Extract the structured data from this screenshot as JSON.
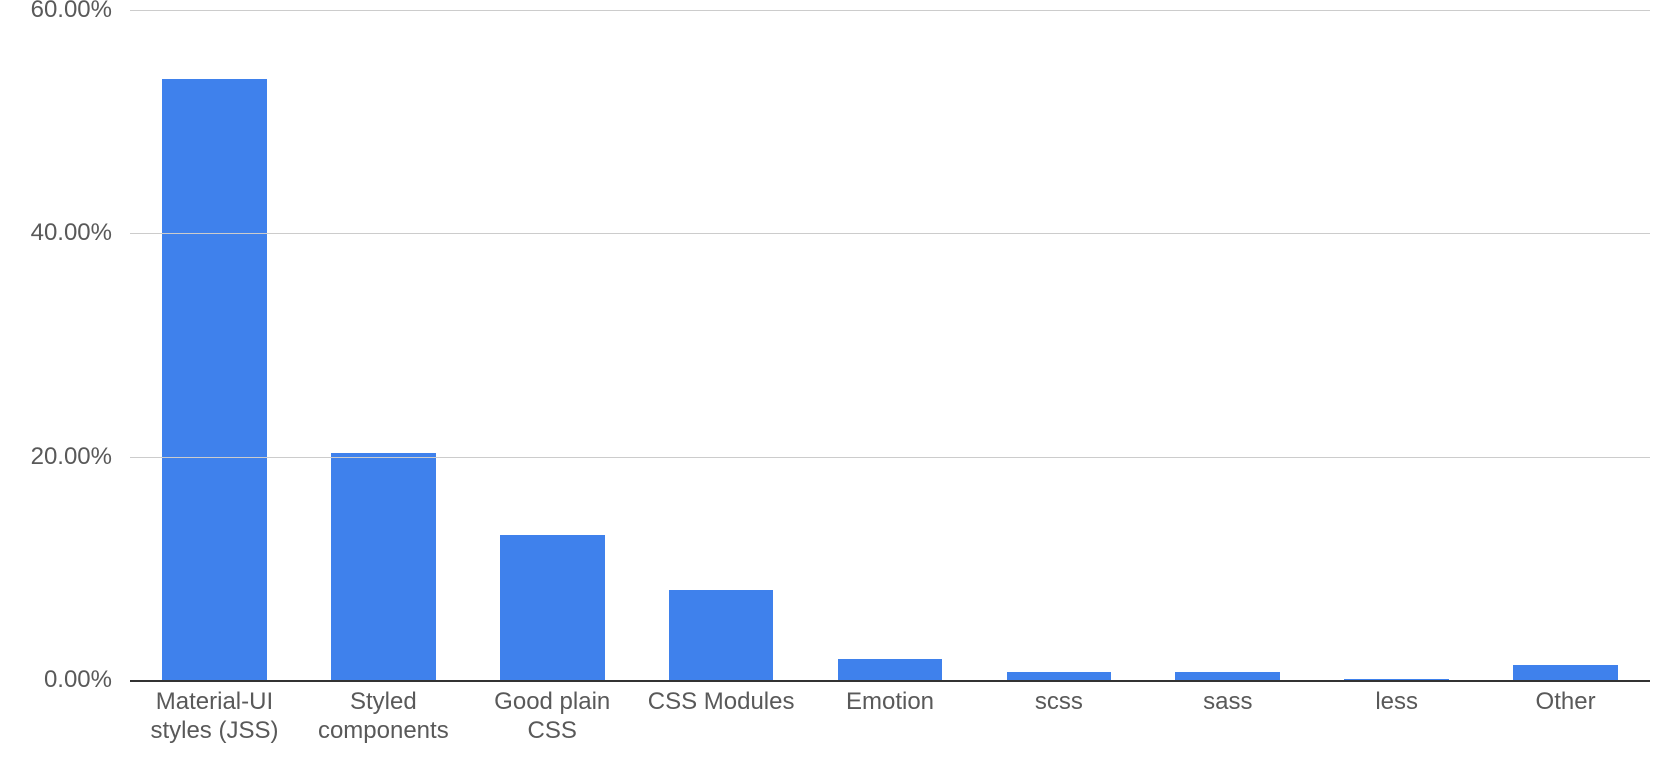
{
  "chart_data": {
    "type": "bar",
    "categories": [
      "Material-UI styles (JSS)",
      "Styled components",
      "Good plain CSS",
      "CSS Modules",
      "Emotion",
      "scss",
      "sass",
      "less",
      "Other"
    ],
    "values": [
      53.8,
      20.3,
      13.0,
      8.1,
      1.9,
      0.7,
      0.7,
      0.1,
      1.3
    ],
    "title": "",
    "xlabel": "",
    "ylabel": "",
    "ylim": [
      0,
      60
    ],
    "y_ticks": [
      0,
      20,
      40,
      60
    ],
    "y_tick_labels": [
      "0.00%",
      "20.00%",
      "40.00%",
      "60.00%"
    ],
    "bar_color": "#3f81ec",
    "grid_color": "#cccccc"
  }
}
